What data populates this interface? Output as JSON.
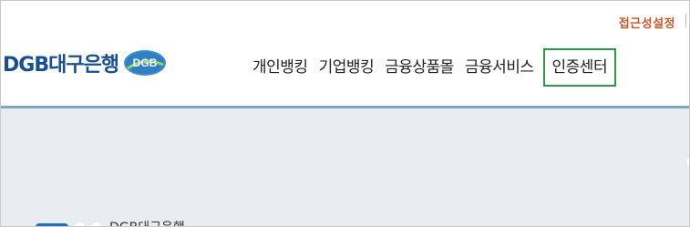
{
  "header": {
    "util_link": "접근성설정",
    "logo": {
      "text": "DGB대구은행",
      "badge_text": "DGB"
    },
    "gnb": [
      {
        "label": "개인뱅킹",
        "active": false
      },
      {
        "label": "기업뱅킹",
        "active": false
      },
      {
        "label": "금융상품몰",
        "active": false
      },
      {
        "label": "금융서비스",
        "active": false
      },
      {
        "label": "인증센터",
        "active": true
      }
    ]
  },
  "main": {
    "carousel": {
      "active_index": 0,
      "slide_count": 3,
      "current_label": "DGB대구은행"
    }
  },
  "colors": {
    "brand_blue": "#1a4f8f",
    "util_orange": "#c8582b",
    "highlight_green": "#2e9a49",
    "divider": "#7fa6bd",
    "content_bg": "#e9ecf1",
    "pager_active": "#1f6fc7"
  }
}
